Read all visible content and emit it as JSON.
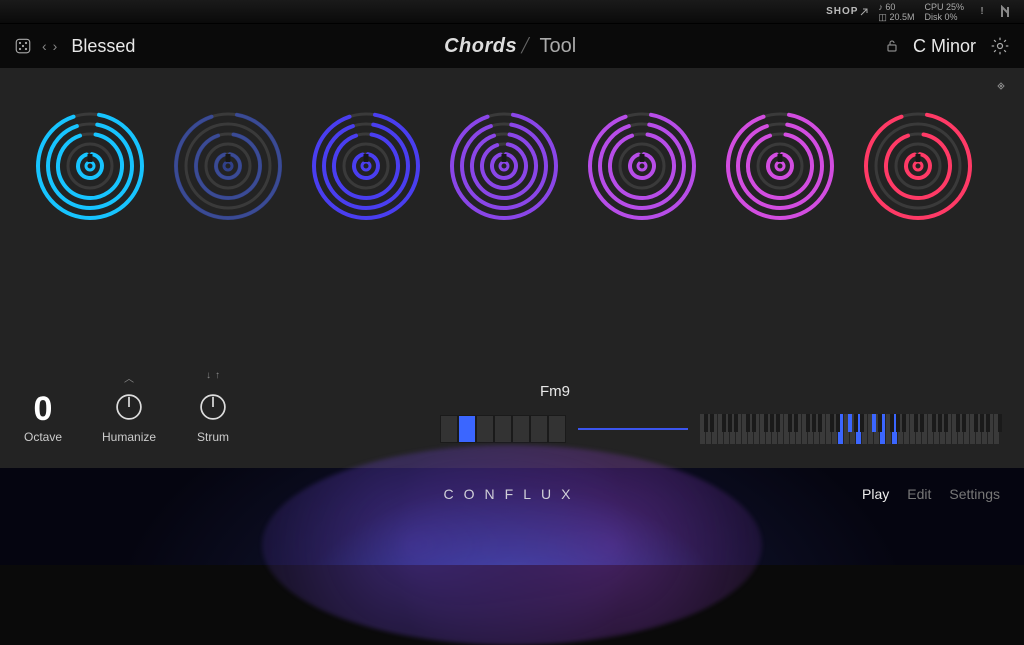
{
  "topbar": {
    "shop_label": "SHOP",
    "tempo_icon": "♪",
    "tempo_value": "60",
    "voices_icon": "◫",
    "voices_value": "20.5M",
    "cpu_label": "CPU",
    "cpu_value": "25%",
    "disk_label": "Disk",
    "disk_value": "0%"
  },
  "header": {
    "preset_name": "Blessed",
    "title_bold": "Chords",
    "title_light": "Tool",
    "key": "C Minor"
  },
  "rings": [
    {
      "color": "#17c4ff",
      "arcs": [
        1,
        1,
        1,
        0,
        1
      ]
    },
    {
      "color": "#3d5adf",
      "arcs": [
        1,
        0,
        1,
        0,
        1
      ],
      "dim": true
    },
    {
      "color": "#4a3ef0",
      "arcs": [
        1,
        1,
        1,
        0,
        1
      ]
    },
    {
      "color": "#8a46e8",
      "arcs": [
        1,
        1,
        1,
        1,
        1
      ]
    },
    {
      "color": "#b74de8",
      "arcs": [
        1,
        1,
        1,
        0,
        1
      ]
    },
    {
      "color": "#d24de0",
      "arcs": [
        1,
        1,
        1,
        0,
        1
      ]
    },
    {
      "color": "#ff3a66",
      "arcs": [
        1,
        0,
        1,
        0,
        1
      ]
    }
  ],
  "controls": {
    "octave_value": "0",
    "octave_label": "Octave",
    "humanize_label": "Humanize",
    "strum_label": "Strum"
  },
  "chord": {
    "name": "Fm9",
    "pads_active_index": 1,
    "pads_count": 7,
    "highlighted_white": [
      23,
      26,
      30,
      32
    ],
    "highlighted_black": [
      24,
      28
    ]
  },
  "footer": {
    "logo": "CONFLUX",
    "tabs": [
      "Play",
      "Edit",
      "Settings"
    ],
    "active_tab": "Play"
  }
}
